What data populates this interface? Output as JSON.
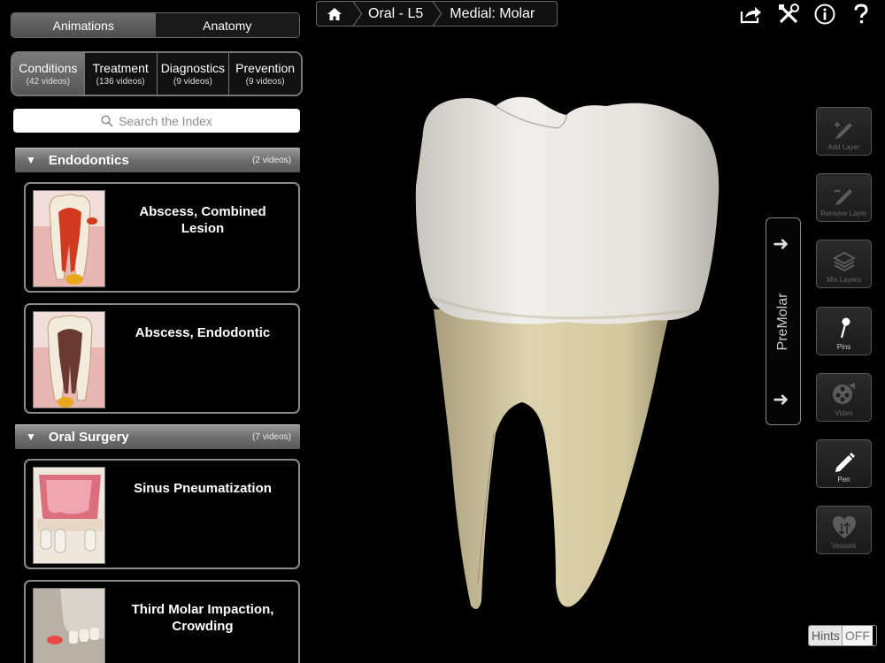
{
  "top_tabs": [
    {
      "label": "Animations",
      "active": true
    },
    {
      "label": "Anatomy",
      "active": false
    }
  ],
  "categories": [
    {
      "label": "Conditions",
      "count": "(42 videos)",
      "active": true
    },
    {
      "label": "Treatment",
      "count": "(136 videos)",
      "active": false
    },
    {
      "label": "Diagnostics",
      "count": "(9 videos)",
      "active": false
    },
    {
      "label": "Prevention",
      "count": "(9 videos)",
      "active": false
    }
  ],
  "search": {
    "placeholder": "Search the Index"
  },
  "sections": [
    {
      "name": "Endodontics",
      "count": "(2 videos)",
      "items": [
        {
          "title": "Abscess, Combined Lesion"
        },
        {
          "title": "Abscess, Endodontic"
        }
      ]
    },
    {
      "name": "Oral Surgery",
      "count": "(7 videos)",
      "items": [
        {
          "title": "Sinus Pneumatization"
        },
        {
          "title": "Third Molar Impaction, Crowding"
        }
      ]
    }
  ],
  "breadcrumb": {
    "level1": "Oral - L5",
    "level2": "Medial: Molar"
  },
  "side_nav": {
    "label": "PreMolar"
  },
  "tools": [
    {
      "label": "Add Layer",
      "enabled": false,
      "icon": "add-layer-icon"
    },
    {
      "label": "Remove Layer",
      "enabled": false,
      "icon": "remove-layer-icon"
    },
    {
      "label": "Mix Layers",
      "enabled": false,
      "icon": "layers-icon"
    },
    {
      "label": "Pins",
      "enabled": true,
      "icon": "pin-icon"
    },
    {
      "label": "Video",
      "enabled": false,
      "icon": "video-reel-icon"
    },
    {
      "label": "Pen",
      "enabled": true,
      "icon": "pen-icon"
    },
    {
      "label": "Vessels",
      "enabled": false,
      "icon": "heart-icon"
    }
  ],
  "hints": {
    "label": "Hints",
    "state": "OFF"
  },
  "colors": {
    "accent_gray": "#6e6e6e",
    "tooth_crown": "#e8e6e2",
    "tooth_root": "#d8cfa8"
  }
}
